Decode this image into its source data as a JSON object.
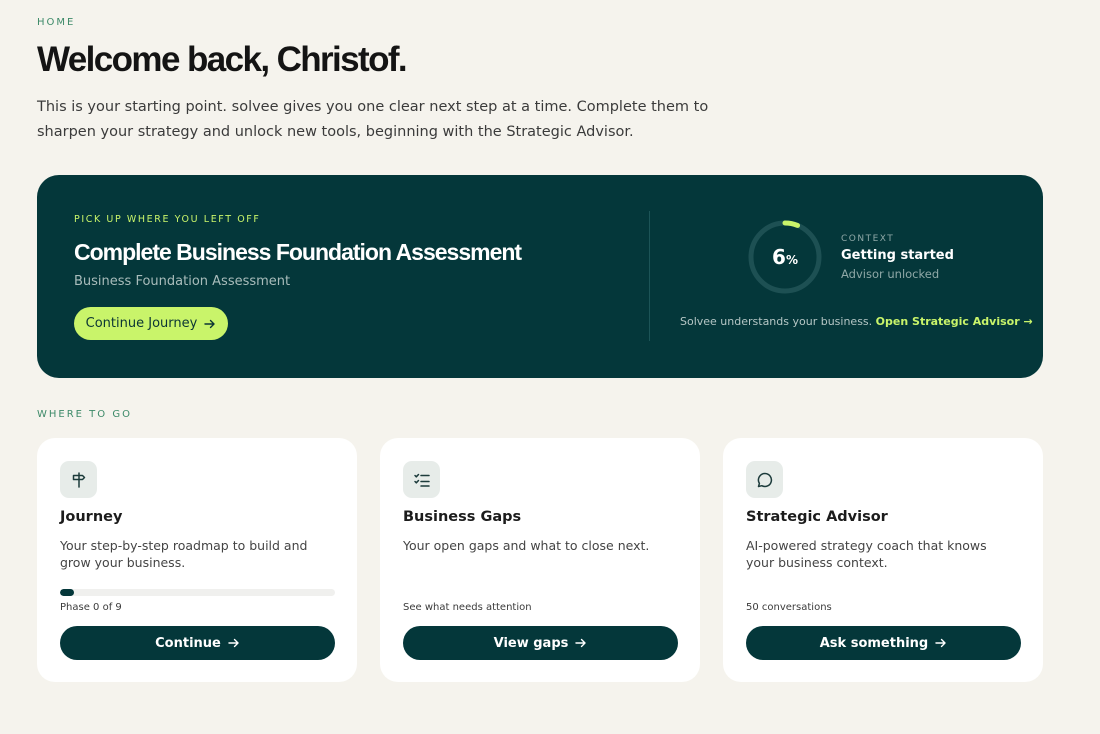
{
  "breadcrumb": "HOME",
  "title": "Welcome back, Christof.",
  "intro": "This is your starting point. solvee gives you one clear next step at a time. Complete them to sharpen your strategy and unlock new tools, beginning with the Strategic Advisor.",
  "hero": {
    "eyebrow": "PICK UP WHERE YOU LEFT OFF",
    "title": "Complete Business Foundation Assessment",
    "subtitle": "Business Foundation Assessment",
    "button_label": "Continue Journey",
    "context": {
      "progress_value": "6",
      "progress_unit": "%",
      "progress_fraction": 0.06,
      "label": "CONTEXT",
      "status": "Getting started",
      "note": "Advisor unlocked"
    },
    "footer_text": "Solvee understands your business.",
    "footer_link": "Open Strategic Advisor →"
  },
  "section_label": "WHERE TO GO",
  "cards": [
    {
      "icon": "signpost-icon",
      "title": "Journey",
      "description": "Your step-by-step roadmap to build and grow your business.",
      "progress_fraction": 0.05,
      "meta": "Phase 0 of 9",
      "button_label": "Continue"
    },
    {
      "icon": "checklist-icon",
      "title": "Business Gaps",
      "description": "Your open gaps and what to close next.",
      "meta": "See what needs attention",
      "button_label": "View gaps"
    },
    {
      "icon": "chat-bubble-icon",
      "title": "Strategic Advisor",
      "description": "AI-powered strategy coach that knows your business context.",
      "meta": "50 conversations",
      "button_label": "Ask something"
    }
  ],
  "colors": {
    "background": "#f5f3ed",
    "hero": "#04373a",
    "accent": "#c9f46a",
    "label_green": "#3d8a69"
  }
}
